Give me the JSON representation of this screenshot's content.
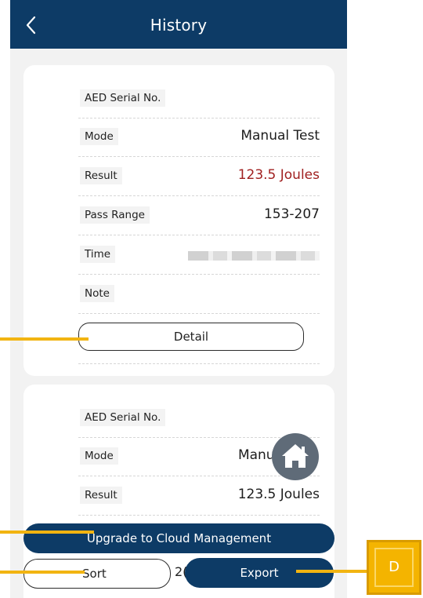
{
  "header": {
    "title": "History"
  },
  "cards": [
    {
      "rows": [
        {
          "label": "AED Serial No.",
          "value": ""
        },
        {
          "label": "Mode",
          "value": "Manual Test"
        },
        {
          "label": "Result",
          "value": "123.5 Joules"
        },
        {
          "label": "Pass Range",
          "value": "153-207"
        },
        {
          "label": "Time",
          "value": ""
        },
        {
          "label": "Note",
          "value": ""
        }
      ],
      "detail_label": "Detail"
    },
    {
      "rows": [
        {
          "label": "AED Serial No.",
          "value": ""
        },
        {
          "label": "Mode",
          "value": "Manua"
        },
        {
          "label": "Result",
          "value": "123.5 Joules"
        }
      ],
      "partial_text": "2("
    }
  ],
  "buttons": {
    "cloud": "Upgrade to Cloud Management",
    "sort": "Sort",
    "export": "Export"
  },
  "callout": {
    "badge": "D"
  },
  "colors": {
    "header": "#0d3b66",
    "result_value": "#a02020",
    "callout": "#f2b411"
  },
  "icons": {
    "back": "chevron-left-icon",
    "home": "home-icon"
  }
}
